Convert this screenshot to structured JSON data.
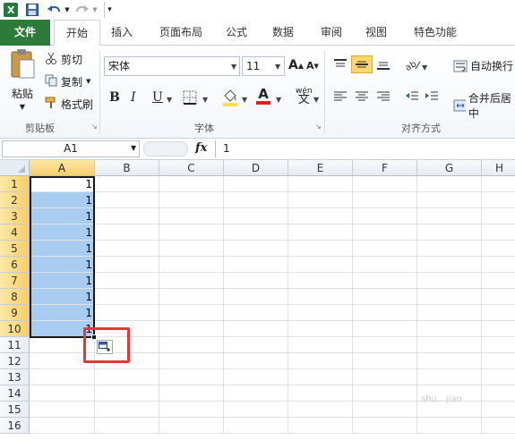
{
  "quick_access": {
    "app_icon": "excel-logo-icon",
    "save_icon": "save-icon",
    "undo_icon": "undo-icon",
    "redo_icon": "redo-icon",
    "customize_icon": "customize-qat-icon"
  },
  "tabs": [
    {
      "label": "文件"
    },
    {
      "label": "开始"
    },
    {
      "label": "插入"
    },
    {
      "label": "页面布局"
    },
    {
      "label": "公式"
    },
    {
      "label": "数据"
    },
    {
      "label": "审阅"
    },
    {
      "label": "视图"
    },
    {
      "label": "特色功能"
    }
  ],
  "clipboard": {
    "paste": "粘贴",
    "cut": "剪切",
    "copy": "复制",
    "format_painter": "格式刷",
    "group_label": "剪贴板"
  },
  "font": {
    "name": "宋体",
    "size": "11",
    "bold": "B",
    "italic": "I",
    "underline": "U",
    "grow": "A",
    "shrink": "A",
    "font_color_glyph": "A",
    "phonetic": "wén",
    "group_label": "字体",
    "fill_color": "#f6e24a",
    "font_color": "#e0201b"
  },
  "alignment": {
    "wrap_text": "自动换行",
    "merge_center": "合并后居中",
    "group_label": "对齐方式"
  },
  "formula_bar": {
    "name_box": "A1",
    "fx": "fx",
    "value": "1"
  },
  "sheet": {
    "columns": [
      "A",
      "B",
      "C",
      "D",
      "E",
      "F",
      "G",
      "H"
    ],
    "rows": [
      "1",
      "2",
      "3",
      "4",
      "5",
      "6",
      "7",
      "8",
      "9",
      "10",
      "11",
      "12",
      "13",
      "14",
      "15",
      "16"
    ],
    "column_a_values": [
      "1",
      "1",
      "1",
      "1",
      "1",
      "1",
      "1",
      "1",
      "1",
      "1"
    ],
    "selected_column": "A",
    "selection_fill": "#a9cdf1",
    "autofill_options_icon": "autofill-options-icon",
    "highlight_color": "#e0383b"
  },
  "watermark": "shu…jiao"
}
